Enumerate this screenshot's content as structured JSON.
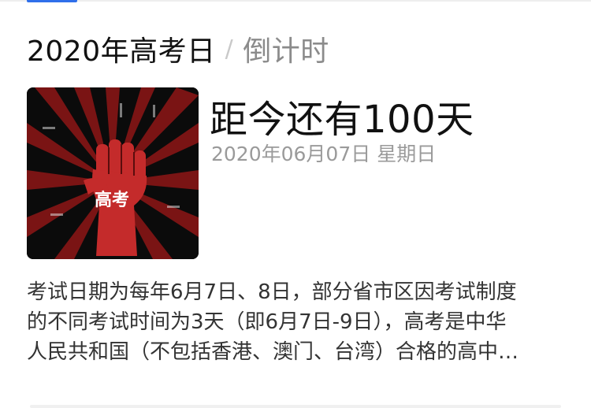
{
  "header": {
    "title": "2020年高考日",
    "separator": "/",
    "subtitle": "倒计时"
  },
  "card": {
    "countdown": "距今还有100天",
    "date": "2020年06月07日 星期日",
    "image_alt_icon": "fist-icon",
    "image_text": "高考"
  },
  "description": {
    "lines": [
      "考试日期为每年6月7日、8日，部分省市区因考试制度",
      "的不同考试时间为3天（即6月7日-9日），高考是中华",
      "人民共和国（不包括香港、澳门、台湾）合格的高中…"
    ]
  },
  "colors": {
    "accent": "#2f6fea",
    "thumb_ray": "#7a1414",
    "fist": "#c42b2b"
  }
}
